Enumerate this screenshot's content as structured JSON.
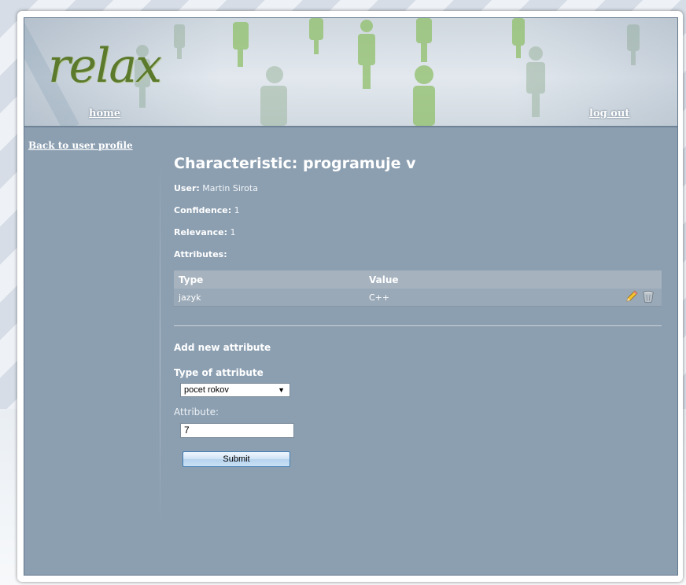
{
  "header": {
    "logo_text": "relax",
    "home_link": "home",
    "logout_link": "log out"
  },
  "sidebar": {
    "back_link": "Back to user profile"
  },
  "main": {
    "title": "Characteristic: programuje v",
    "user_label": "User:",
    "user_value": "Martin Sirota",
    "confidence_label": "Confidence:",
    "confidence_value": "1",
    "relevance_label": "Relevance:",
    "relevance_value": "1",
    "attributes_label": "Attributes:",
    "table": {
      "columns": [
        "Type",
        "Value"
      ],
      "rows": [
        {
          "type": "jazyk",
          "value": "C++",
          "actions": [
            "edit-icon",
            "delete-icon"
          ]
        }
      ]
    },
    "add_heading": "Add new attribute",
    "type_label": "Type of attribute",
    "type_selected": "pocet rokov",
    "attribute_label": "Attribute:",
    "attribute_value": "7",
    "submit_label": "Submit"
  },
  "colors": {
    "content_bg": "#8c9fb1",
    "table_header_bg": "#a6b2be",
    "table_row_bg": "#9aa9b7",
    "logo_green": "#5c7a2c",
    "submit_border": "#3e7bb4"
  }
}
